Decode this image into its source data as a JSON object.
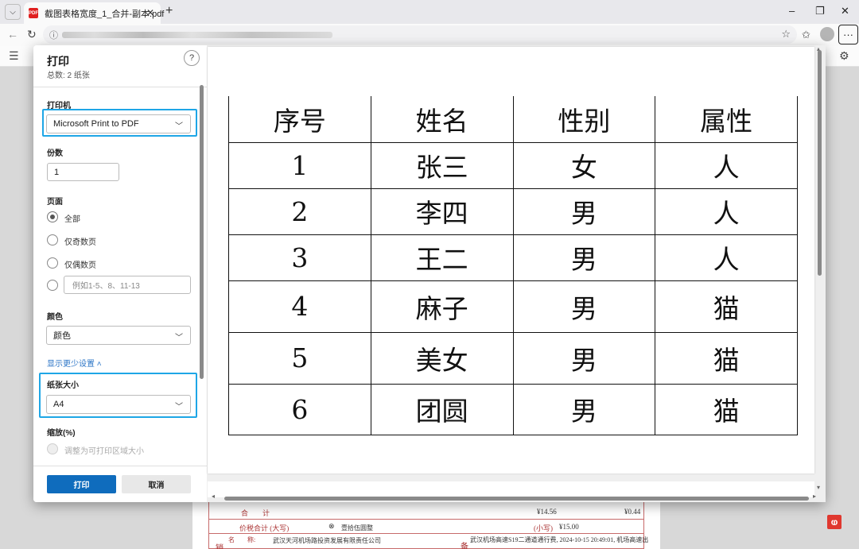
{
  "browser": {
    "tab_title": "截图表格宽度_1_合并-副本.pdf",
    "tab_close": "✕",
    "new_tab": "+",
    "pdf_icon_label": "PDF",
    "win_min": "–",
    "win_restore": "❐",
    "win_close": "✕",
    "more": "···"
  },
  "dialog": {
    "title": "打印",
    "subtitle": "总数: 2 纸张",
    "help": "?",
    "printer_label": "打印机",
    "printer_value": "Microsoft Print to PDF",
    "copies_label": "份数",
    "copies_value": "1",
    "pages_label": "页面",
    "pages_options": [
      "全部",
      "仅奇数页",
      "仅偶数页"
    ],
    "pages_placeholder": "例如1-5、8、11-13",
    "color_label": "颜色",
    "color_value": "颜色",
    "less_settings": "显示更少设置 ˄",
    "paper_label": "纸张大小",
    "paper_value": "A4",
    "scale_label": "缩放(%)",
    "scale_option": "调整为可打印区域大小",
    "print_button": "打印",
    "cancel_button": "取消"
  },
  "preview_table": {
    "headers": [
      "序号",
      "姓名",
      "性别",
      "属性"
    ],
    "rows": [
      [
        "1",
        "张三",
        "女",
        "人"
      ],
      [
        "2",
        "李四",
        "男",
        "人"
      ],
      [
        "3",
        "王二",
        "男",
        "人"
      ],
      [
        "4",
        "麻子",
        "男",
        "猫"
      ],
      [
        "5",
        "美女",
        "男",
        "猫"
      ],
      [
        "6",
        "团圆",
        "男",
        "猫"
      ]
    ]
  },
  "background_invoice": {
    "row1_label": "合　　计",
    "row1_amount1": "¥14.56",
    "row1_amount2": "¥0.44",
    "row2_label": "价税合计 (大写)",
    "row2_value": "壹拾伍圆整",
    "row2_small_label": "(小写)",
    "row2_small_value": "¥15.00",
    "row3_label": "名　　称:",
    "row3_value": "武汉天河机场路投资发展有限责任公司",
    "row3_note": "武汉机场高速S19二通道通行费, 2024-10-15 20:49:01, 机场高速出",
    "row3_side": "备",
    "row3_left": "销"
  }
}
